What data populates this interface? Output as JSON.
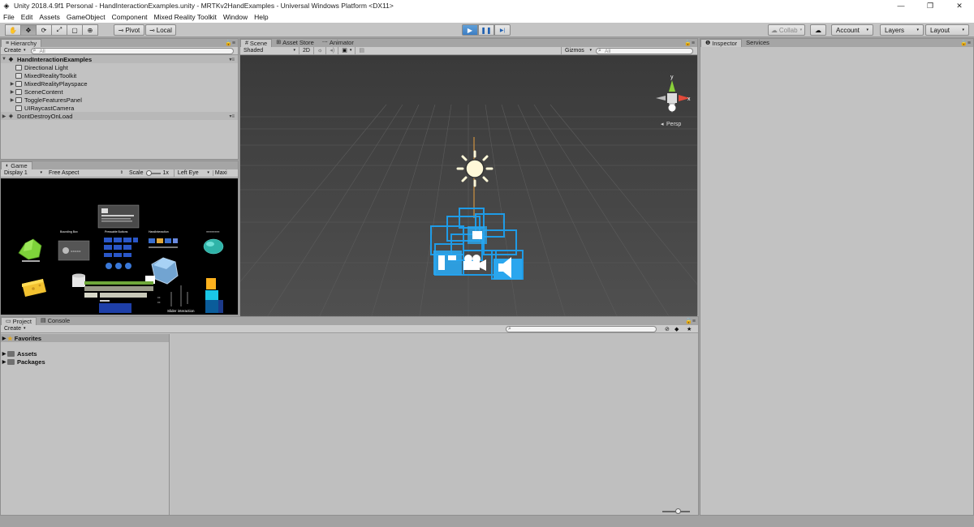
{
  "window": {
    "title": "Unity 2018.4.9f1 Personal - HandInteractionExamples.unity - MRTKv2HandExamples - Universal Windows Platform <DX11>",
    "minimize": "—",
    "maximize": "❐",
    "close": "✕"
  },
  "menu": [
    "File",
    "Edit",
    "Assets",
    "GameObject",
    "Component",
    "Mixed Reality Toolkit",
    "Window",
    "Help"
  ],
  "toolbar": {
    "tools": [
      "✋",
      "✥",
      "⟳",
      "⤢",
      "▢",
      "⊕"
    ],
    "pivot": "Pivot",
    "local": "Local",
    "play": "▶",
    "pause": "❚❚",
    "step": "▶|",
    "collab": "Collab",
    "cloud": "☁",
    "account": "Account",
    "layers": "Layers",
    "layout": "Layout"
  },
  "hierarchy": {
    "tab": "Hierarchy",
    "create": "Create",
    "search_placeholder": "All",
    "scene": "HandInteractionExamples",
    "items": [
      {
        "label": "Directional Light",
        "fold": ""
      },
      {
        "label": "MixedRealityToolkit",
        "fold": ""
      },
      {
        "label": "MixedRealityPlayspace",
        "fold": "▶"
      },
      {
        "label": "SceneContent",
        "fold": "▶"
      },
      {
        "label": "ToggleFeaturesPanel",
        "fold": "▶"
      },
      {
        "label": "UIRaycastCamera",
        "fold": ""
      }
    ],
    "dontdestroy": "DontDestroyOnLoad"
  },
  "game": {
    "tab": "Game",
    "display": "Display 1",
    "aspect": "Free Aspect",
    "scale_label": "Scale",
    "scale_value": "1x",
    "eye": "Left Eye",
    "maxi": "Maxi",
    "labels": {
      "bounding": "Bounding Box",
      "press": "Pressable Buttons",
      "hand": "HandInteraction",
      "slider": "Slider interaction"
    }
  },
  "scene": {
    "tabs": [
      "Scene",
      "Asset Store",
      "Animator"
    ],
    "shaded": "Shaded",
    "mode2d": "2D",
    "gizmos": "Gizmos",
    "search_placeholder": "All",
    "persp": "Persp",
    "axis_y": "y",
    "axis_x": "x"
  },
  "inspector": {
    "tab": "Inspector",
    "services": "Services"
  },
  "project": {
    "tabs": [
      "Project",
      "Console"
    ],
    "create": "Create",
    "favorites": "Favorites",
    "folders": [
      "Assets",
      "Packages"
    ]
  }
}
